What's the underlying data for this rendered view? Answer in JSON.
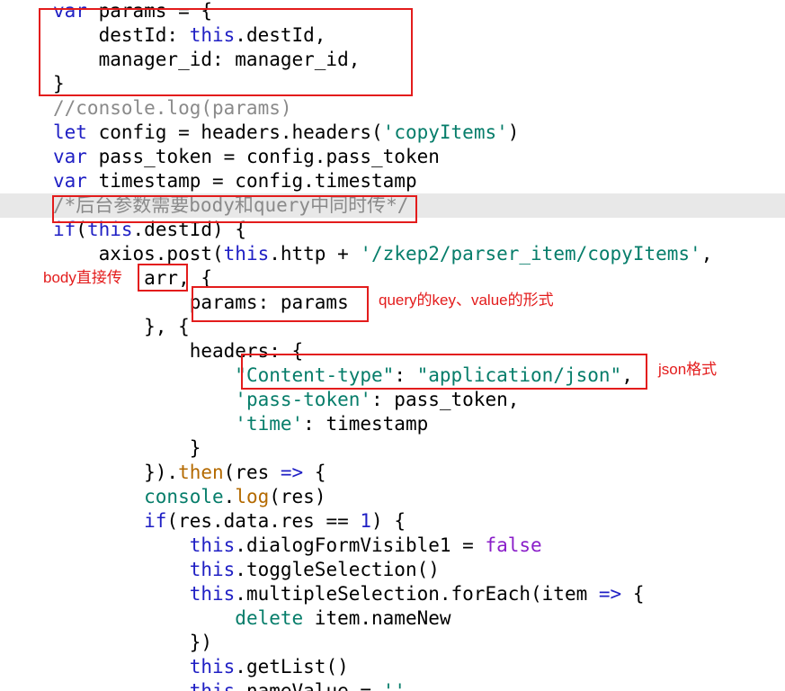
{
  "code_lines": [
    {
      "tokens": [
        {
          "t": "var",
          "c": "kw-blue"
        },
        {
          "t": " params = {",
          "c": "dark"
        }
      ]
    },
    {
      "tokens": [
        {
          "t": "    destId: ",
          "c": "dark"
        },
        {
          "t": "this",
          "c": "this"
        },
        {
          "t": ".destId,",
          "c": "dark"
        }
      ]
    },
    {
      "tokens": [
        {
          "t": "    manager_id: manager_id,",
          "c": "dark"
        }
      ]
    },
    {
      "tokens": [
        {
          "t": "}",
          "c": "dark"
        }
      ]
    },
    {
      "tokens": [
        {
          "t": "//console.log(params)",
          "c": "cmt"
        }
      ]
    },
    {
      "tokens": [
        {
          "t": "let",
          "c": "kw-blue"
        },
        {
          "t": " config = headers.headers(",
          "c": "dark"
        },
        {
          "t": "'copyItems'",
          "c": "str"
        },
        {
          "t": ")",
          "c": "dark"
        }
      ]
    },
    {
      "tokens": [
        {
          "t": "var",
          "c": "kw-blue"
        },
        {
          "t": " pass_token = config.pass_token",
          "c": "dark"
        }
      ]
    },
    {
      "tokens": [
        {
          "t": "var",
          "c": "kw-blue"
        },
        {
          "t": " timestamp = config.timestamp",
          "c": "dark"
        }
      ]
    },
    {
      "tokens": [
        {
          "t": "/*后台参数需要body和query中同时传*/",
          "c": "cmt"
        }
      ]
    },
    {
      "tokens": [
        {
          "t": "if",
          "c": "kw-blue"
        },
        {
          "t": "(",
          "c": "dark"
        },
        {
          "t": "this",
          "c": "this"
        },
        {
          "t": ".destId) {",
          "c": "dark"
        }
      ]
    },
    {
      "tokens": [
        {
          "t": "    axios.post(",
          "c": "dark"
        },
        {
          "t": "this",
          "c": "this"
        },
        {
          "t": ".http + ",
          "c": "dark"
        },
        {
          "t": "'/zkep2/parser_item/copyItems'",
          "c": "str"
        },
        {
          "t": ",",
          "c": "dark"
        }
      ]
    },
    {
      "tokens": [
        {
          "t": "        arr, {",
          "c": "dark"
        }
      ]
    },
    {
      "tokens": [
        {
          "t": "            params: params",
          "c": "dark"
        }
      ]
    },
    {
      "tokens": [
        {
          "t": "        }, {",
          "c": "dark"
        }
      ]
    },
    {
      "tokens": [
        {
          "t": "            headers: {",
          "c": "dark"
        }
      ]
    },
    {
      "tokens": [
        {
          "t": "                ",
          "c": "dark"
        },
        {
          "t": "\"Content-type\"",
          "c": "str"
        },
        {
          "t": ": ",
          "c": "dark"
        },
        {
          "t": "\"application/json\"",
          "c": "str"
        },
        {
          "t": ",",
          "c": "dark"
        }
      ]
    },
    {
      "tokens": [
        {
          "t": "                ",
          "c": "dark"
        },
        {
          "t": "'pass-token'",
          "c": "str"
        },
        {
          "t": ": pass_token,",
          "c": "dark"
        }
      ]
    },
    {
      "tokens": [
        {
          "t": "                ",
          "c": "dark"
        },
        {
          "t": "'time'",
          "c": "str"
        },
        {
          "t": ": timestamp",
          "c": "dark"
        }
      ]
    },
    {
      "tokens": [
        {
          "t": "            }",
          "c": "dark"
        }
      ]
    },
    {
      "tokens": [
        {
          "t": "        }).",
          "c": "dark"
        },
        {
          "t": "then",
          "c": "fn-orange"
        },
        {
          "t": "(res ",
          "c": "dark"
        },
        {
          "t": "=>",
          "c": "kw-blue"
        },
        {
          "t": " {",
          "c": "dark"
        }
      ]
    },
    {
      "tokens": [
        {
          "t": "        console",
          "c": "str"
        },
        {
          "t": ".",
          "c": "dark"
        },
        {
          "t": "log",
          "c": "fn-orange"
        },
        {
          "t": "(res)",
          "c": "dark"
        }
      ]
    },
    {
      "tokens": [
        {
          "t": "        if",
          "c": "kw-blue"
        },
        {
          "t": "(res.data.res == ",
          "c": "dark"
        },
        {
          "t": "1",
          "c": "num"
        },
        {
          "t": ") {",
          "c": "dark"
        }
      ]
    },
    {
      "tokens": [
        {
          "t": "            ",
          "c": "dark"
        },
        {
          "t": "this",
          "c": "this"
        },
        {
          "t": ".dialogFormVisible1 = ",
          "c": "dark"
        },
        {
          "t": "false",
          "c": "bool"
        }
      ]
    },
    {
      "tokens": [
        {
          "t": "            ",
          "c": "dark"
        },
        {
          "t": "this",
          "c": "this"
        },
        {
          "t": ".toggleSelection()",
          "c": "dark"
        }
      ]
    },
    {
      "tokens": [
        {
          "t": "            ",
          "c": "dark"
        },
        {
          "t": "this",
          "c": "this"
        },
        {
          "t": ".multipleSelection.forEach(item ",
          "c": "dark"
        },
        {
          "t": "=>",
          "c": "kw-blue"
        },
        {
          "t": " {",
          "c": "dark"
        }
      ]
    },
    {
      "tokens": [
        {
          "t": "                ",
          "c": "dark"
        },
        {
          "t": "delete",
          "c": "str"
        },
        {
          "t": " item.nameNew",
          "c": "dark"
        }
      ]
    },
    {
      "tokens": [
        {
          "t": "            })",
          "c": "dark"
        }
      ]
    },
    {
      "tokens": [
        {
          "t": "            ",
          "c": "dark"
        },
        {
          "t": "this",
          "c": "this"
        },
        {
          "t": ".getList()",
          "c": "dark"
        }
      ]
    },
    {
      "tokens": [
        {
          "t": "            ",
          "c": "dark"
        },
        {
          "t": "this",
          "c": "this"
        },
        {
          "t": ".nameValue = ",
          "c": "dark"
        },
        {
          "t": "''",
          "c": "str"
        }
      ]
    }
  ],
  "annotations": {
    "body_label": "body直接传",
    "query_label": "query的key、value的形式",
    "json_label": "json格式"
  },
  "colors": {
    "annotation": "#e31c1c",
    "keyword": "#1f1fc4",
    "string": "#067d6a",
    "comment": "#8a8a8a",
    "highlight_line": "#e8e8e8"
  }
}
